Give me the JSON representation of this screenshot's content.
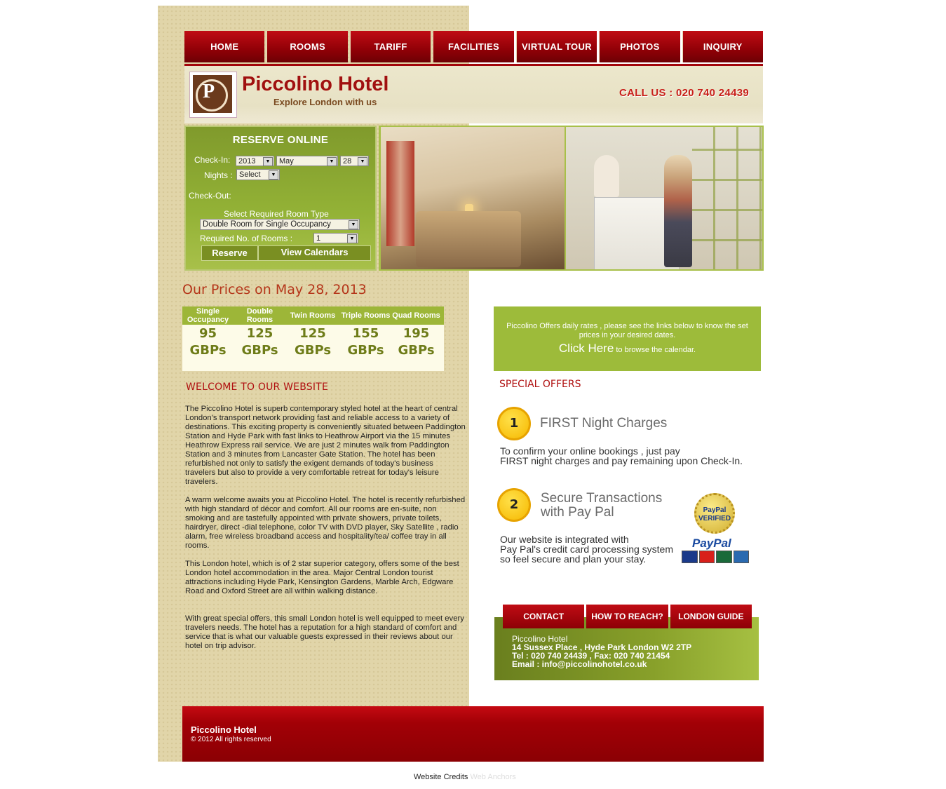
{
  "nav": {
    "items": [
      "HOME",
      "ROOMS",
      "TARIFF",
      "FACILITIES",
      "VIRTUAL TOUR",
      "PHOTOS",
      "INQUIRY"
    ]
  },
  "header": {
    "logo_letter": "P",
    "brand": "Piccolino Hotel",
    "tagline": "Explore London with us",
    "call_us": "CALL US : 020 740 24439"
  },
  "reserve": {
    "title": "RESERVE ONLINE",
    "checkin_label": "Check-In:",
    "year": "2013",
    "month": "May",
    "day": "28",
    "nights_label": "Nights :",
    "nights_value": "Select",
    "checkout_label": "Check-Out:",
    "room_type_label": "Select Required Room Type",
    "room_type_value": "Double Room for Single Occupancy",
    "rooms_label": "Required No. of Rooms :",
    "rooms_value": "1",
    "reserve_button": "Reserve",
    "calendars_button": "View Calendars"
  },
  "prices": {
    "title": "Our Prices on May 28, 2013",
    "columns": [
      {
        "header": "Single Occupancy",
        "price": "95",
        "unit": "GBPs"
      },
      {
        "header": "Double Rooms",
        "price": "125",
        "unit": "GBPs"
      },
      {
        "header": "Twin Rooms",
        "price": "125",
        "unit": "GBPs"
      },
      {
        "header": "Triple Rooms",
        "price": "155",
        "unit": "GBPs"
      },
      {
        "header": "Quad Rooms",
        "price": "195",
        "unit": "GBPs"
      }
    ]
  },
  "welcome": {
    "title": "WELCOME TO OUR WEBSITE",
    "paragraphs": [
      "The Piccolino Hotel is superb contemporary styled hotel at the heart of central London's transport network providing fast and reliable access to a variety of destinations. This exciting property is conveniently situated between Paddington Station and Hyde Park with fast links to Heathrow Airport via the 15 minutes Heathrow Express rail service. We are just 2 minutes walk from Paddington Station and 3 minutes from Lancaster Gate Station. The hotel has been refurbished not only to satisfy the exigent demands of today's business travelers but also to provide a very comfortable retreat for today's leisure travelers.",
      "A warm welcome awaits you at Piccolino Hotel. The hotel is recently refurbished with high standard of décor and comfort. All our rooms are en-suite, non smoking and are tastefully appointed with private showers, private toilets, hairdryer, direct -dial telephone, color TV with DVD player, Sky Satellite , radio alarm, free wireless broadband access and hospitality/tea/ coffee tray in all rooms.",
      "This London hotel, which is of 2 star superior category, offers some of the best London hotel accommodation in the area. Major Central London tourist attractions including Hyde Park, Kensington Gardens, Marble Arch, Edgware Road and Oxford Street are all within walking distance.",
      "With great special offers, this small London hotel is well equipped to meet every travelers needs. The hotel has a reputation for a high standard of comfort and service that is what our valuable guests expressed in their reviews about our hotel on trip advisor."
    ]
  },
  "info": {
    "text": "Piccolino Offers daily rates , please see the links below to know the set prices in your desired dates.",
    "click_here": "Click Here",
    "click_rest": " to browse the calendar."
  },
  "special": {
    "title": "SPECIAL OFFERS",
    "offers": [
      {
        "num": "1",
        "heading": "FIRST Night Charges",
        "line1": "To confirm your online bookings , just pay",
        "line2": "FIRST night charges and pay remaining upon Check-In.",
        "line3": ""
      },
      {
        "num": "2",
        "heading": "Secure Transactions",
        "heading2": "with Pay Pal",
        "line1": "Our website is integrated with",
        "line2": "Pay Pal's credit card processing system",
        "line3": "so feel secure and plan your stay."
      }
    ],
    "paypal_seal": "PayPal VERIFIED",
    "paypal_word": "PayPal"
  },
  "contact_nav": [
    "CONTACT",
    "HOW TO REACH?",
    "LONDON GUIDE"
  ],
  "contact": {
    "name": "Piccolino Hotel",
    "address": "14 Sussex Place , Hyde Park London W2 2TP",
    "phone": "Tel : 020 740 24439 , Fax: 020 740 21454",
    "email": "Email : info@piccolinohotel.co.uk"
  },
  "footer": {
    "name": "Piccolino Hotel",
    "copyright": "© 2012 All rights reserved"
  },
  "credits": {
    "label": "Website Credits",
    "link": "Web Anchors"
  }
}
